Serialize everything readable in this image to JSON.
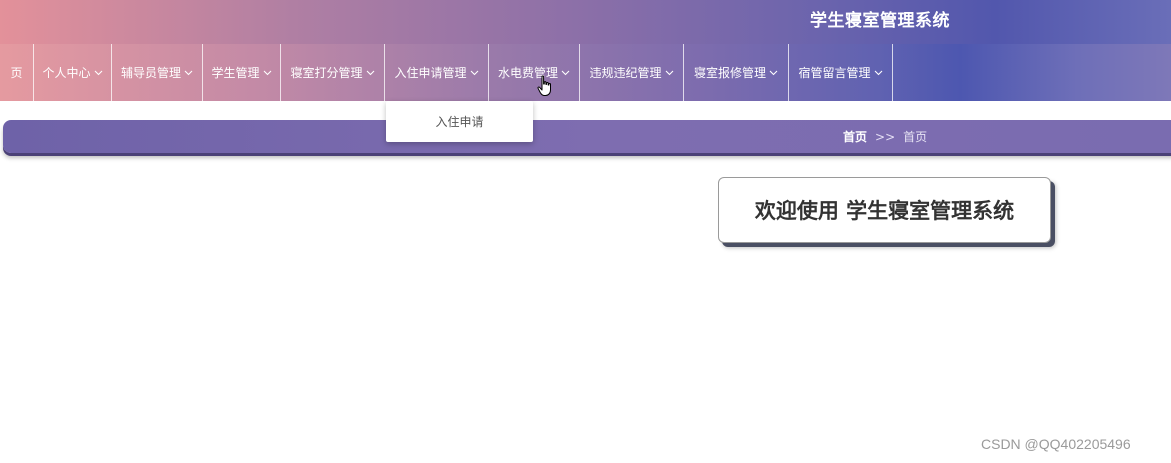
{
  "header": {
    "title": "学生寝室管理系统"
  },
  "nav": {
    "items": [
      {
        "label": "页",
        "has_dropdown": false
      },
      {
        "label": "个人中心",
        "has_dropdown": true
      },
      {
        "label": "辅导员管理",
        "has_dropdown": true
      },
      {
        "label": "学生管理",
        "has_dropdown": true
      },
      {
        "label": "寝室打分管理",
        "has_dropdown": true
      },
      {
        "label": "入住申请管理",
        "has_dropdown": true
      },
      {
        "label": "水电费管理",
        "has_dropdown": true
      },
      {
        "label": "违规违纪管理",
        "has_dropdown": true
      },
      {
        "label": "寝室报修管理",
        "has_dropdown": true
      },
      {
        "label": "宿管留言管理",
        "has_dropdown": true
      }
    ],
    "dropdown_open_under": "入住申请管理",
    "dropdown_items": [
      "入住申请"
    ]
  },
  "breadcrumb": {
    "home": "首页",
    "separator": ">>",
    "current": "首页"
  },
  "welcome": {
    "text": "欢迎使用 学生寝室管理系统"
  },
  "watermark": "CSDN @QQ402205496",
  "colors": {
    "header_start": "#e3919a",
    "header_end": "#5257ad",
    "breadcrumb_bar": "#7e6db0",
    "welcome_text": "#333333"
  },
  "icons": {
    "dropdown_indicator": "chevron-down-icon",
    "pointer": "hand-cursor-icon"
  }
}
